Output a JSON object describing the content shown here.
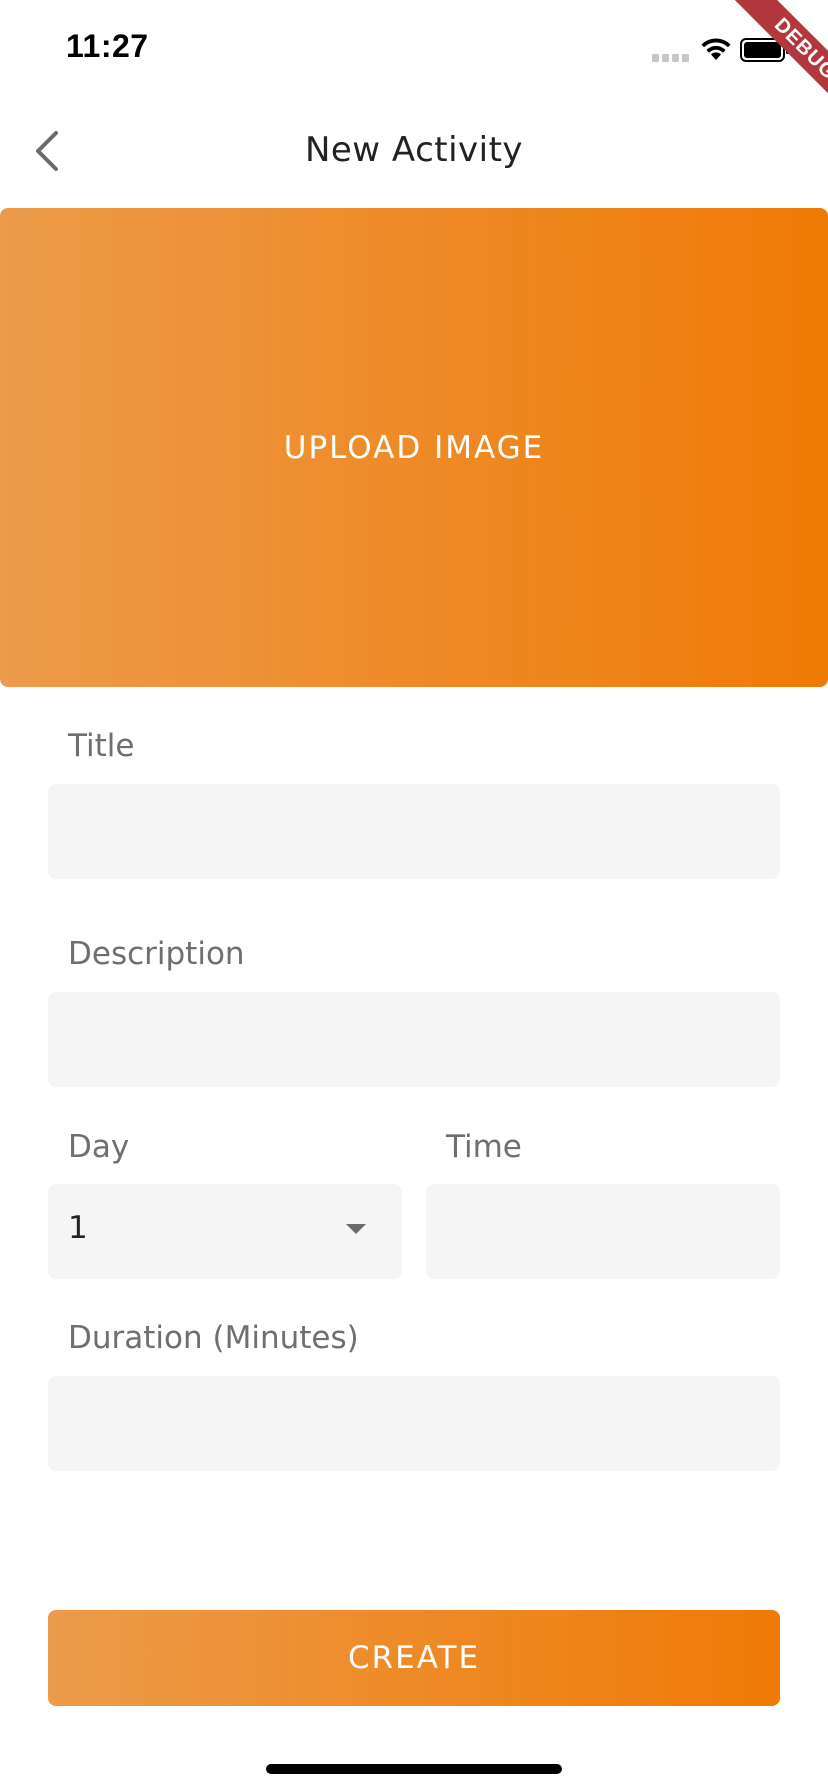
{
  "status_bar": {
    "time": "11:27"
  },
  "debug_banner": "DEBUG",
  "app_bar": {
    "title": "New Activity"
  },
  "upload": {
    "label": "UPLOAD IMAGE"
  },
  "form": {
    "title_label": "Title",
    "title_value": "",
    "description_label": "Description",
    "description_value": "",
    "day_label": "Day",
    "day_value": "1",
    "time_label": "Time",
    "time_value": "",
    "duration_label": "Duration (Minutes)",
    "duration_value": ""
  },
  "create_button": {
    "label": "CREATE"
  },
  "colors": {
    "accent_start": "#ec9b4a",
    "accent_end": "#f07a05",
    "field_background": "#f5f5f5",
    "label_text": "#6f6f6f",
    "debug_ribbon": "#b3383d"
  }
}
